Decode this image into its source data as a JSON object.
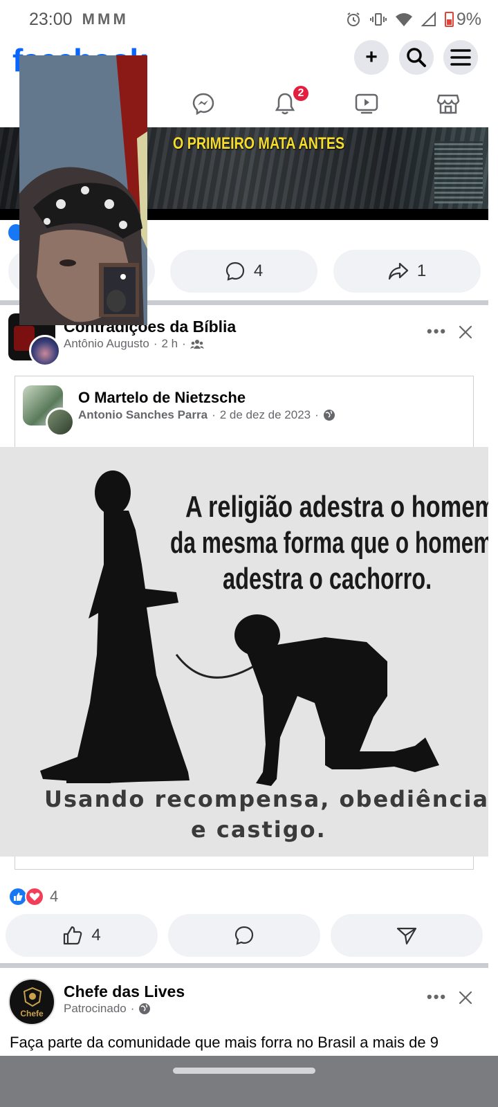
{
  "status_bar": {
    "time": "23:00",
    "mail_icons": "M M M",
    "battery": "9%"
  },
  "header": {
    "logo": "facebook",
    "plus_label": "+",
    "notification_count": "2"
  },
  "video_post": {
    "caption": "O PRIMEIRO MATA ANTES",
    "comment_count": "4",
    "share_count": "1"
  },
  "post": {
    "group_name": "Contradições da Bíblia",
    "author": "Antônio Augusto",
    "time": "2 h",
    "separator": "·",
    "shared": {
      "page_name": "O Martelo de Nietzsche",
      "author": "Antonio Sanches Parra",
      "date": "2 de dez de 2023"
    },
    "meme": {
      "top_line1": "A religião adestra o homem",
      "top_line2": "da mesma forma que o homem",
      "top_line3": "adestra o cachorro.",
      "bottom_line1": "Usando recompensa, obediência",
      "bottom_line2": "e castigo."
    },
    "reaction_count": "4",
    "like_count": "4"
  },
  "sponsored_post": {
    "name": "Chefe das Lives",
    "label": "Patrocinado",
    "separator": "·",
    "avatar_text": "Chefe",
    "text": "Faça parte da comunidade que mais forra no Brasil a mais de 9"
  },
  "colors": {
    "facebook_blue": "#0866ff",
    "badge_red": "#e41e3f",
    "caption_yellow": "#f5dd2a"
  }
}
